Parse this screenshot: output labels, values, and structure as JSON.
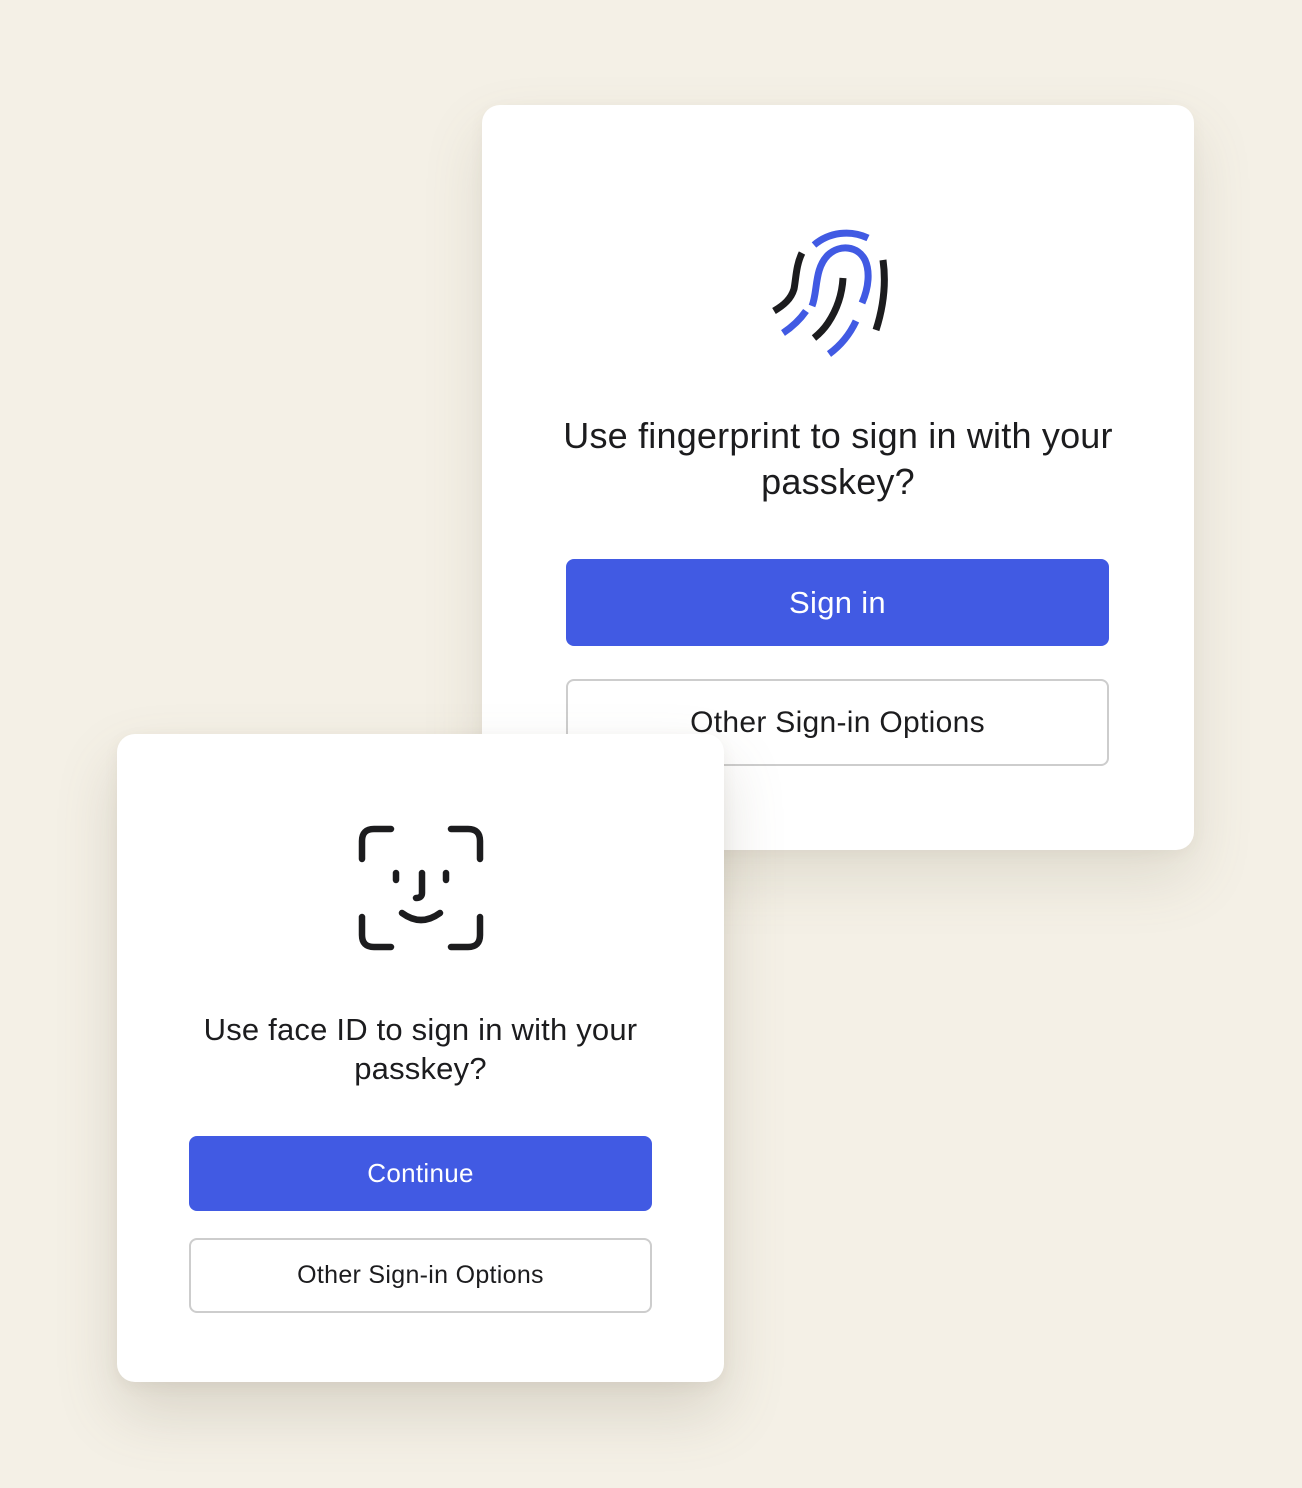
{
  "colors": {
    "background": "#f4f0e6",
    "card": "#ffffff",
    "primary_button": "#415ae3",
    "fingerprint_accent": "#415ae3",
    "icon_dark": "#1c1c1e",
    "secondary_border": "#cdcdcd"
  },
  "fingerprint_dialog": {
    "icon": "fingerprint-icon",
    "prompt": "Use fingerprint to sign in with your passkey?",
    "primary_button": "Sign in",
    "secondary_button": "Other Sign-in Options"
  },
  "faceid_dialog": {
    "icon": "face-id-icon",
    "prompt": "Use face ID to sign in with your passkey?",
    "primary_button": "Continue",
    "secondary_button": "Other Sign-in Options"
  }
}
